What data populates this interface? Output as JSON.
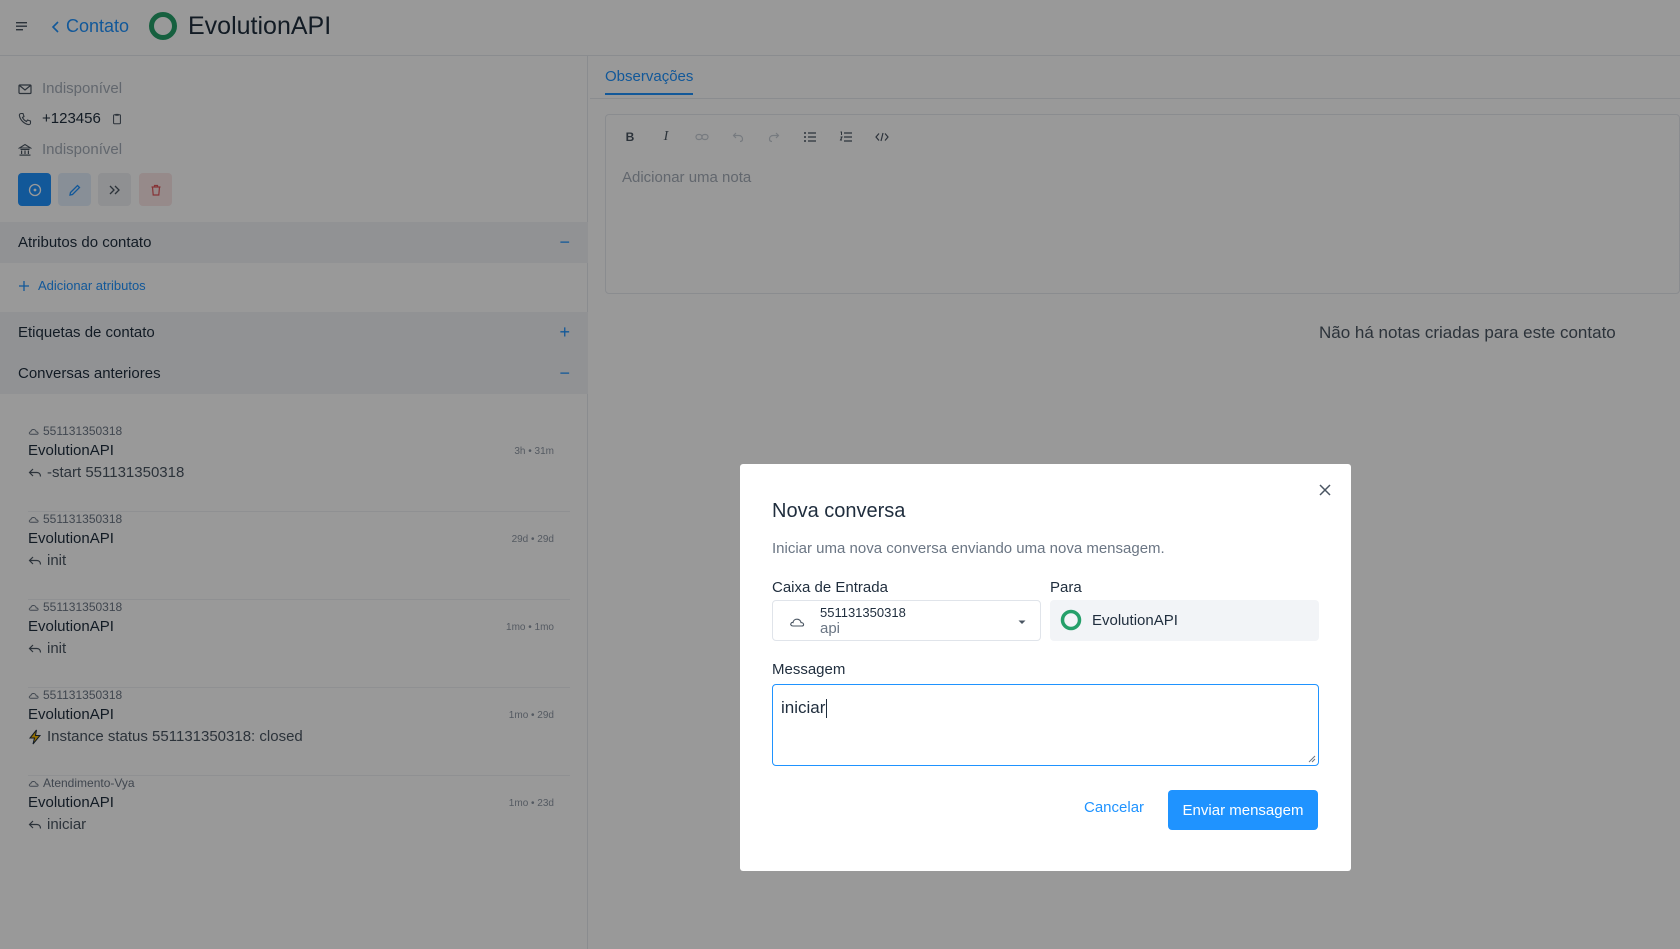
{
  "header": {
    "back_label": "Contato",
    "brand_name": "EvolutionAPI"
  },
  "contact": {
    "email": "Indisponível",
    "phone": "+123456",
    "company": "Indisponível"
  },
  "sections": {
    "attributes_title": "Atributos do contato",
    "attributes_toggle": "−",
    "add_attributes": "Adicionar atributos",
    "labels_title": "Etiquetas de contato",
    "labels_toggle": "+",
    "previous_title": "Conversas anteriores",
    "previous_toggle": "−"
  },
  "conversations": [
    {
      "inbox": "551131350318",
      "name": "EvolutionAPI",
      "time": "3h • 31m",
      "message": "-start 551131350318",
      "icon": "reply-icon"
    },
    {
      "inbox": "551131350318",
      "name": "EvolutionAPI",
      "time": "29d • 29d",
      "message": "init",
      "icon": "reply-icon"
    },
    {
      "inbox": "551131350318",
      "name": "EvolutionAPI",
      "time": "1mo • 1mo",
      "message": "init",
      "icon": "reply-icon"
    },
    {
      "inbox": "551131350318",
      "name": "EvolutionAPI",
      "time": "1mo • 29d",
      "message": "Instance status 551131350318: closed",
      "icon": "bolt-icon"
    },
    {
      "inbox": "Atendimento-Vya",
      "name": "EvolutionAPI",
      "time": "1mo • 23d",
      "message": "iniciar",
      "icon": "reply-icon"
    }
  ],
  "notes": {
    "tab_label": "Observações",
    "placeholder": "Adicionar uma nota",
    "empty_text": "Não há notas criadas para este contato"
  },
  "modal": {
    "title": "Nova conversa",
    "description": "Iniciar uma nova conversa enviando uma nova mensagem.",
    "inbox_label": "Caixa de Entrada",
    "inbox_name": "551131350318",
    "inbox_type": "api",
    "to_label": "Para",
    "to_name": "EvolutionAPI",
    "message_label": "Messagem",
    "message_value": "iniciar",
    "cancel_label": "Cancelar",
    "send_label": "Enviar mensagem"
  },
  "colors": {
    "accent": "#1f93ff",
    "brand": "#25a06a",
    "danger": "#e0555a"
  }
}
